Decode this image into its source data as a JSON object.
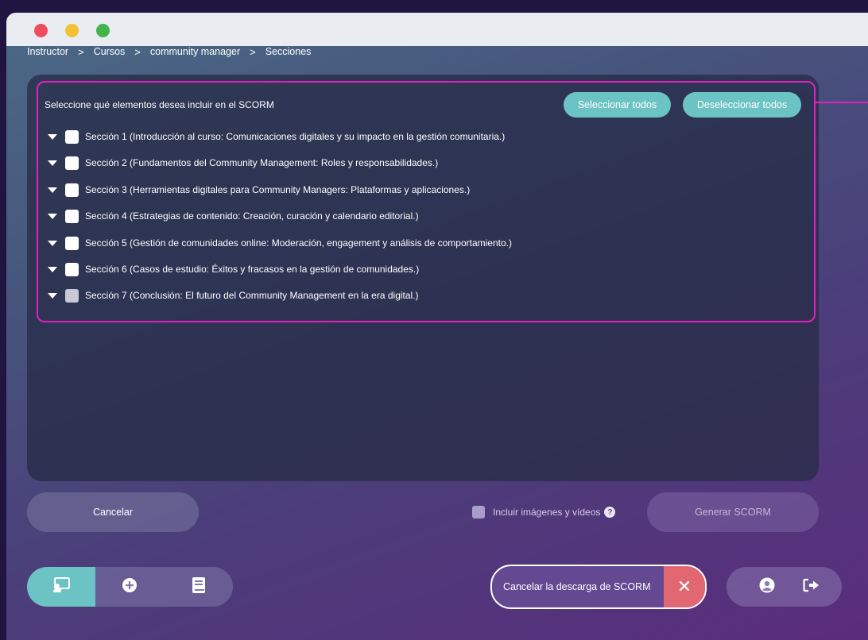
{
  "breadcrumb": {
    "items": [
      "Instructor",
      "Cursos",
      "community manager",
      "Secciones"
    ],
    "separator": ">"
  },
  "selection": {
    "title": "Seleccione qué elementos desea incluir en el SCORM",
    "select_all": "Seleccionar todos",
    "deselect_all": "Deseleccionar todos",
    "sections": [
      "Sección 1 (Introducción al curso: Comunicaciones digitales y su impacto en la gestión comunitaria.)",
      "Sección 2 (Fundamentos del Community Management: Roles y responsabilidades.)",
      "Sección 3 (Herramientas digitales para Community Managers: Plataformas y aplicaciones.)",
      "Sección 4 (Estrategias de contenido: Creación, curación y calendario editorial.)",
      "Sección 5 (Gestión de comunidades online: Moderación, engagement y análisis de comportamiento.)",
      "Sección 6 (Casos de estudio: Éxitos y fracasos en la gestión de comunidades.)",
      "Sección 7 (Conclusión: El futuro del Community Management en la era digital.)"
    ]
  },
  "actions": {
    "cancel": "Cancelar",
    "include_media": "Incluir imágenes y vídeos",
    "help": "?",
    "generate": "Generar SCORM"
  },
  "download": {
    "cancel_label": "Cancelar la descarga de SCORM",
    "close": "✕"
  },
  "icons": {
    "nav": [
      "instructor-board-icon",
      "add-circle-icon",
      "book-icon"
    ],
    "right": [
      "user-circle-icon",
      "logout-icon"
    ]
  },
  "colors": {
    "accent_teal": "#6cc3c4",
    "highlight_magenta": "#e21fbf",
    "danger": "#e16872"
  }
}
